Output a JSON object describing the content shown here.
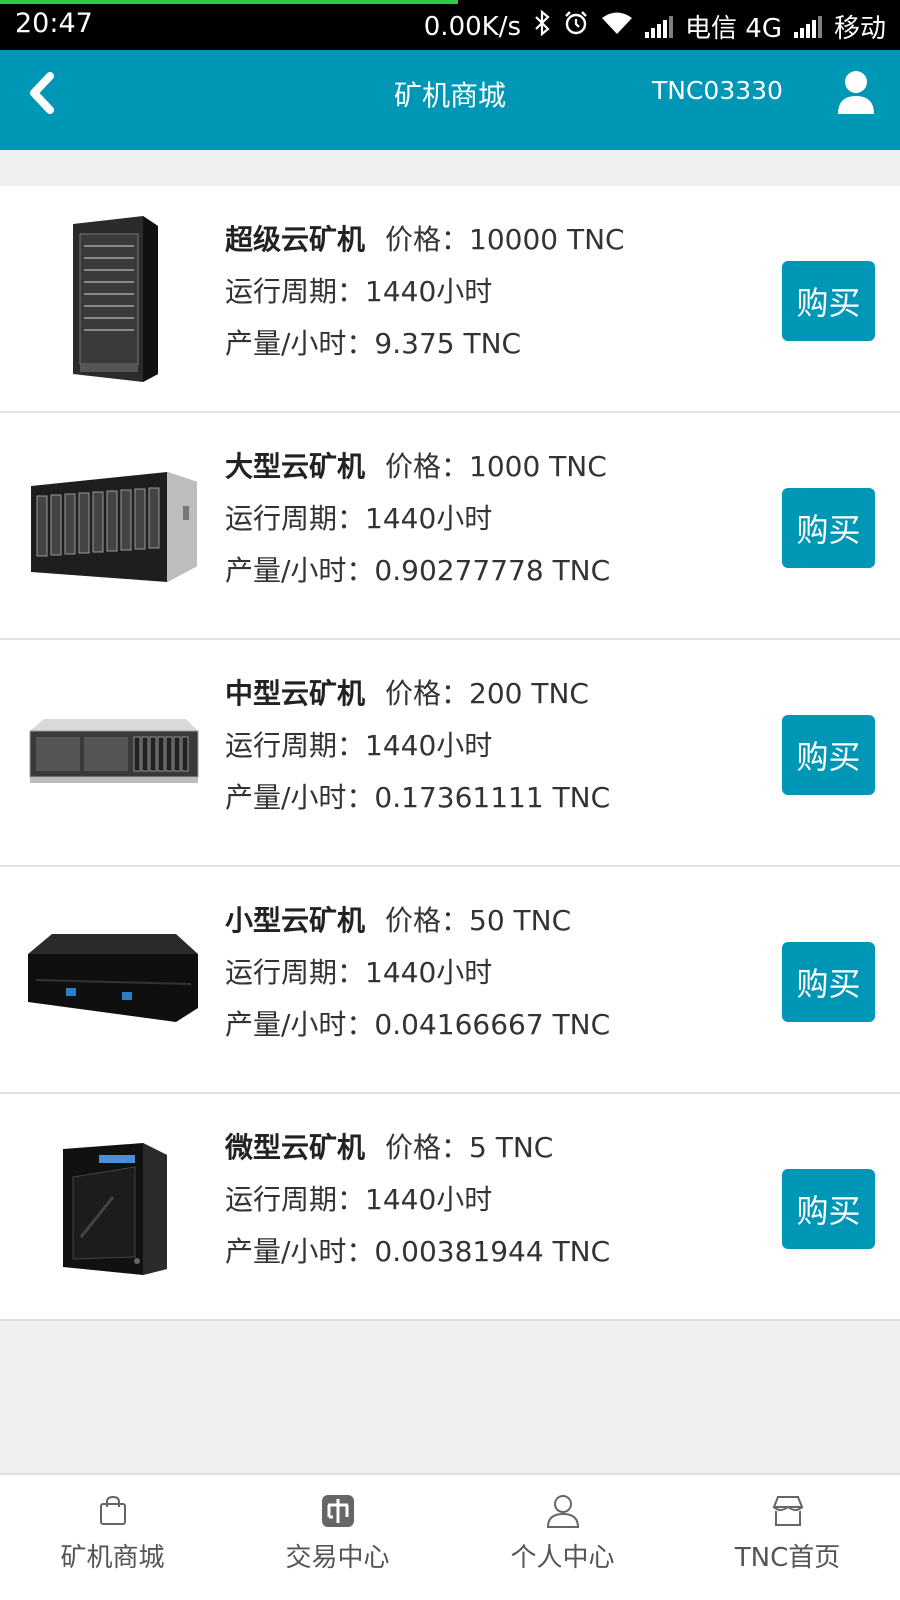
{
  "status": {
    "time": "20:47",
    "net_speed": "0.00K/s",
    "carrier1": "电信 4G",
    "carrier2": "移动",
    "icons": [
      "bluetooth-icon",
      "alarm-icon",
      "wifi-icon",
      "signal-icon"
    ]
  },
  "header": {
    "title": "矿机商城",
    "user_code": "TNC03330",
    "accent": "#0097b7"
  },
  "products": [
    {
      "name": "超级云矿机",
      "price": "价格：10000 TNC",
      "period": "运行周期：1440小时",
      "output": "产量/小时：9.375 TNC",
      "buy_label": "购买"
    },
    {
      "name": "大型云矿机",
      "price": "价格：1000 TNC",
      "period": "运行周期：1440小时",
      "output": "产量/小时：0.90277778 TNC",
      "buy_label": "购买"
    },
    {
      "name": "中型云矿机",
      "price": "价格：200 TNC",
      "period": "运行周期：1440小时",
      "output": "产量/小时：0.17361111 TNC",
      "buy_label": "购买"
    },
    {
      "name": "小型云矿机",
      "price": "价格：50 TNC",
      "period": "运行周期：1440小时",
      "output": "产量/小时：0.04166667 TNC",
      "buy_label": "购买"
    },
    {
      "name": "微型云矿机",
      "price": "价格：5 TNC",
      "period": "运行周期：1440小时",
      "output": "产量/小时：0.00381944 TNC",
      "buy_label": "购买"
    }
  ],
  "nav": [
    {
      "label": "矿机商城",
      "icon": "shopping-bag-icon"
    },
    {
      "label": "交易中心",
      "icon": "market-icon"
    },
    {
      "label": "个人中心",
      "icon": "person-icon"
    },
    {
      "label": "TNC首页",
      "icon": "store-icon"
    }
  ]
}
